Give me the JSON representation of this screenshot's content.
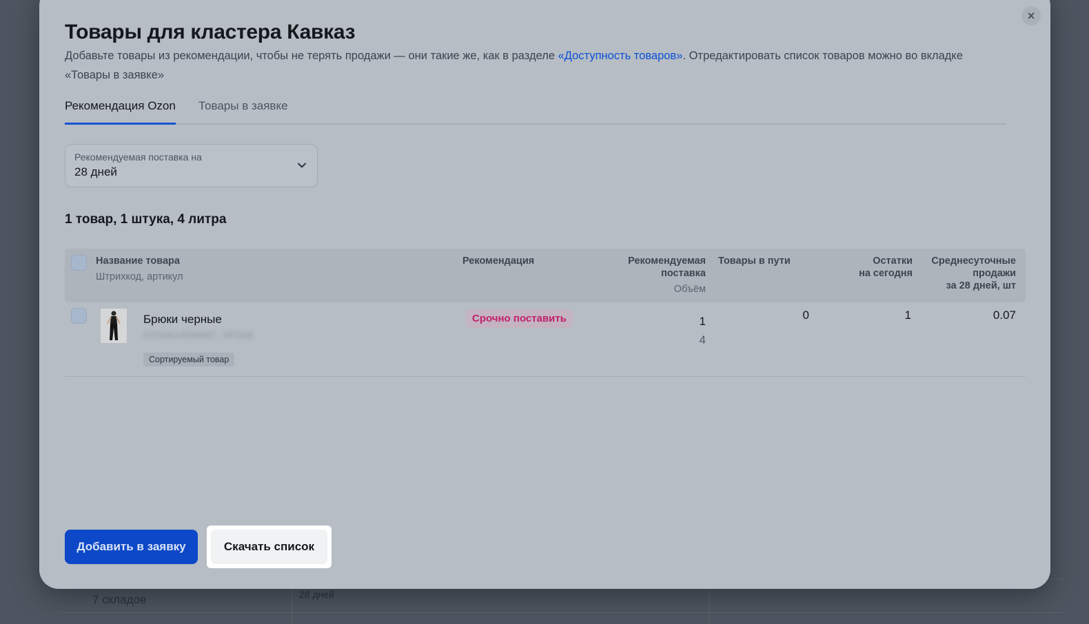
{
  "background": {
    "warehouses_label": "7 складов",
    "days_label": "28 дней"
  },
  "modal": {
    "title": "Товары для кластера Кавказ",
    "description_before": "Добавьте товары из рекомендации, чтобы не терять продажи — они такие же, как в разделе ",
    "description_link": "«Доступность товаров»",
    "description_after": ". Отредактировать список товаров можно во вкладке «Товары в заявке»",
    "close_icon": "×"
  },
  "tabs": [
    {
      "label": "Рекомендация Ozon",
      "active": true
    },
    {
      "label": "Товары в заявке",
      "active": false
    }
  ],
  "select": {
    "label": "Рекомендуемая поставка на",
    "value": "28 дней"
  },
  "summary": "1 товар, 1 штука, 4 литра",
  "table": {
    "headers": {
      "name": "Название товара",
      "name_sub": "Штрихкод, артикул",
      "recommendation": "Рекомендация",
      "recommended_supply_line1": "Рекомендуемая",
      "recommended_supply_line2": "поставка",
      "recommended_supply_sub": "Объём",
      "in_transit": "Товары в пути",
      "stock_line1": "Остатки",
      "stock_line2": "на сегодня",
      "sales_line1": "Среднесуточные",
      "sales_line2": "продажи",
      "sales_line3": "за 28 дней, шт"
    },
    "rows": [
      {
        "name": "Брюки черные",
        "code": "OZN0614599907, SPOIM",
        "tag": "Сортируемый товар",
        "recommendation": "Срочно поставить",
        "recommended_supply": "1",
        "volume": "4",
        "in_transit": "0",
        "stock": "1",
        "avg_sales": "0.07"
      }
    ]
  },
  "actions": {
    "add_label": "Добавить в заявку",
    "download_label": "Скачать список"
  },
  "colors": {
    "primary": "#0c48c7",
    "link": "#0b4fd6",
    "urgent": "#c0206e"
  }
}
